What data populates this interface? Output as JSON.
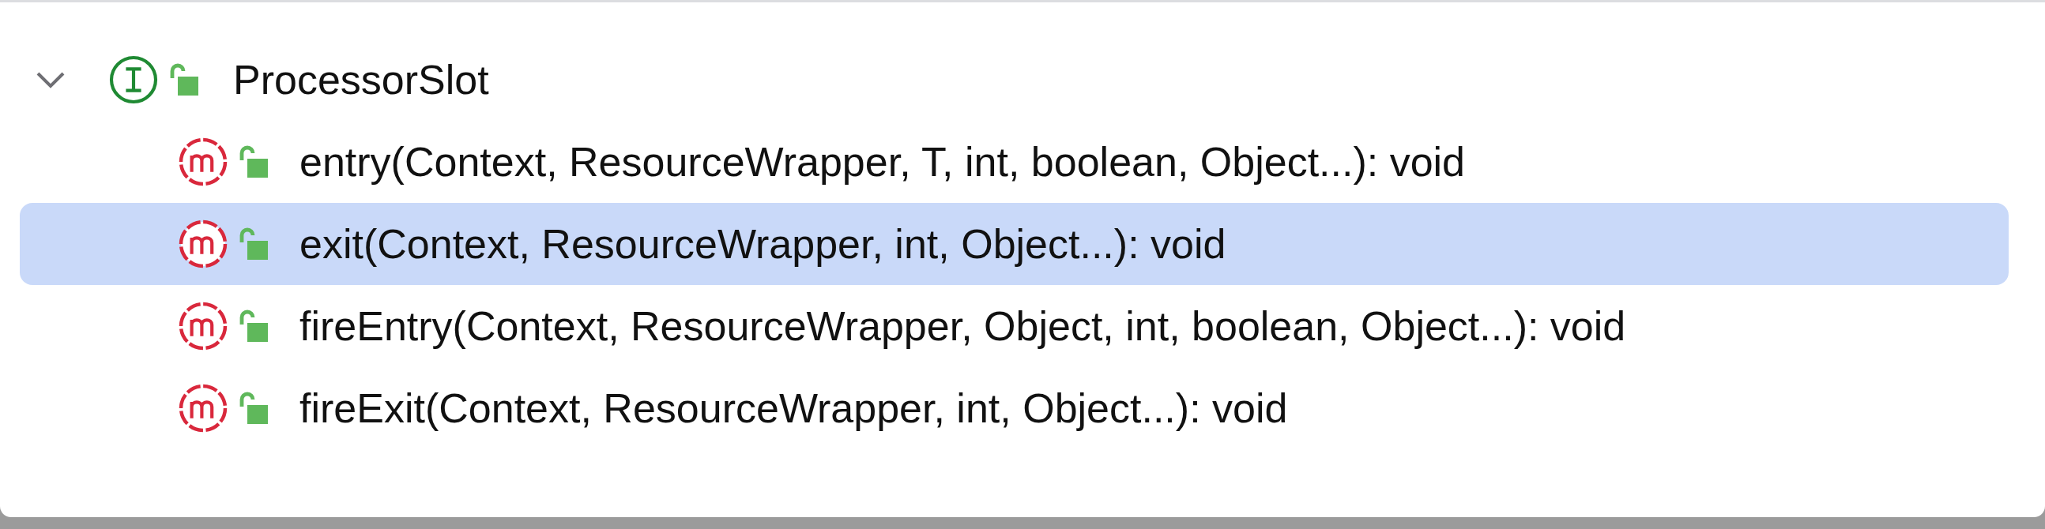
{
  "tree": {
    "label": "ProcessorSlot",
    "kind": "interface",
    "expanded": true,
    "children": [
      {
        "label": "entry(Context, ResourceWrapper, T, int, boolean, Object...): void",
        "kind": "method",
        "selected": false
      },
      {
        "label": "exit(Context, ResourceWrapper, int, Object...): void",
        "kind": "method",
        "selected": true
      },
      {
        "label": "fireEntry(Context, ResourceWrapper, Object, int, boolean, Object...): void",
        "kind": "method",
        "selected": false
      },
      {
        "label": "fireExit(Context, ResourceWrapper, int, Object...): void",
        "kind": "method",
        "selected": false
      }
    ]
  }
}
